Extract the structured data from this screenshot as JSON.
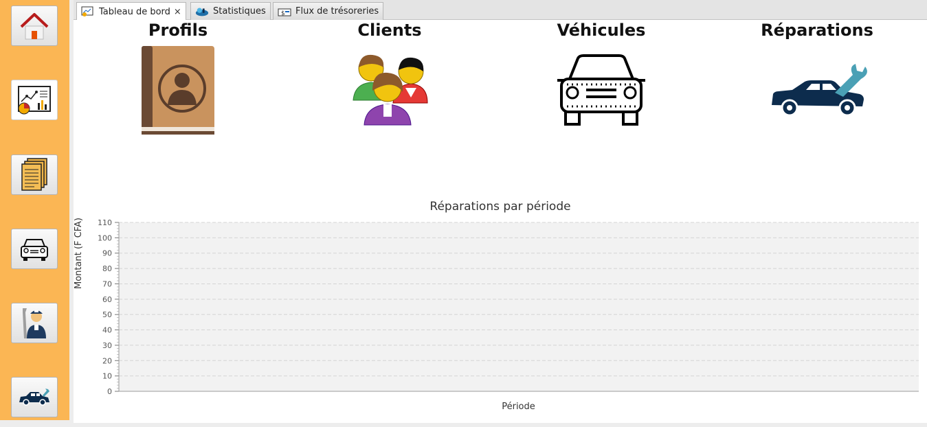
{
  "tabs": [
    {
      "label": "Tableau de bord",
      "icon": "dashboard-icon",
      "active": true,
      "closable": true
    },
    {
      "label": "Statistiques",
      "icon": "statistics-icon",
      "active": false,
      "closable": false
    },
    {
      "label": "Flux de trésoreries",
      "icon": "cash-flow-icon",
      "active": false,
      "closable": false
    }
  ],
  "close_glyph": "×",
  "sidebar": {
    "items": [
      {
        "name": "home-icon"
      },
      {
        "name": "dashboard-chart-icon",
        "active": true
      },
      {
        "name": "documents-icon"
      },
      {
        "name": "car-outline-icon"
      },
      {
        "name": "mechanic-icon"
      },
      {
        "name": "car-repair-icon"
      }
    ]
  },
  "cards": {
    "profils": "Profils",
    "clients": "Clients",
    "vehicules": "Véhicules",
    "reparations": "Réparations"
  },
  "colors": {
    "sidebar": "#fbb654",
    "repair_car": "#0d2c4d",
    "wrench": "#4aa0b5",
    "book": "#c9935e"
  },
  "chart_data": {
    "type": "bar",
    "title": "Réparations par période",
    "xlabel": "Période",
    "ylabel": "Montant (F CFA)",
    "ylim": [
      0,
      110
    ],
    "yticks": [
      0,
      10,
      20,
      30,
      40,
      50,
      60,
      70,
      80,
      90,
      100,
      110
    ],
    "categories": [],
    "values": [],
    "grid": true
  }
}
